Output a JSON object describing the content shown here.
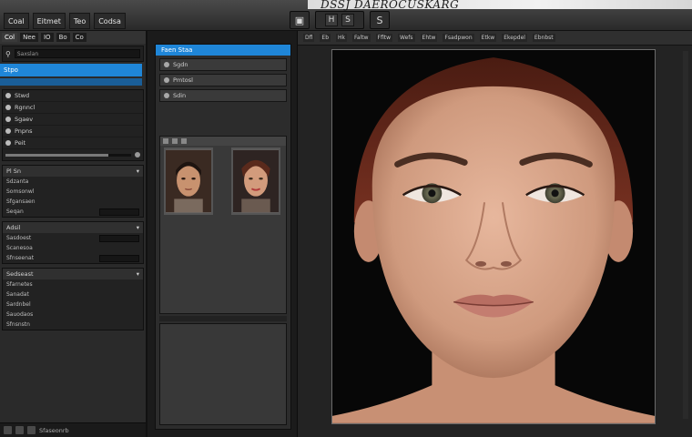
{
  "window": {
    "title": "DSSJ DAEROCUSKARG"
  },
  "menu": {
    "items": [
      "Coal",
      "Eitmet",
      "Teo",
      "Codsa"
    ]
  },
  "toolbar": {
    "btn_a": "H",
    "btn_b": "S",
    "btn_c": "S"
  },
  "left_panel": {
    "tabs": [
      "Col",
      "Nee",
      "IO",
      "Bo",
      "Co"
    ],
    "search_value": "Saxslan",
    "selected_item": "Stpo",
    "layers": [
      "Stwd",
      "Rgnncl",
      "Sgaev",
      "Pnpns",
      "Peit"
    ],
    "section_a": "Pl Sn",
    "props_a": [
      "Sdzanta",
      "Somsonwl",
      "Sfgansaen",
      "Seqan"
    ],
    "section_b": "Adsil",
    "props_b": [
      "Sasdoest",
      "Scanesoa",
      "Sfnseenat"
    ],
    "section_c": "Sedseast",
    "props_c": [
      "Sfarnetes",
      "Sanadat",
      "Sardnbel",
      "Sauodaos",
      "Sfnsnstn"
    ],
    "status": "Sfaseonrb"
  },
  "mid_panel": {
    "header": "Faen Staa",
    "rows": [
      "Sgdn",
      "Pmtosl",
      "Sdin"
    ]
  },
  "viewport": {
    "tools": [
      "Dfl",
      "Eb",
      "Hk",
      "Faltw",
      "Ffltw",
      "Wefs",
      "Ehtw",
      "Fsadpwon",
      "Etkw",
      "Ekepdel",
      "Ebnbst"
    ]
  },
  "colors": {
    "accent": "#1f86d8",
    "panel": "#2a2a2a",
    "skin": "#d9a890",
    "hair": "#6a2a1c"
  }
}
